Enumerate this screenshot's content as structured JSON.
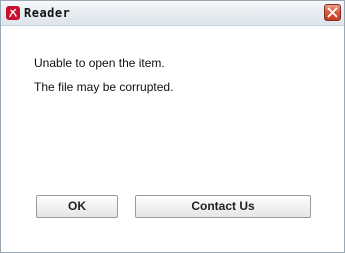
{
  "window": {
    "title": "Reader",
    "close_symbol": "✕"
  },
  "dialog": {
    "line1": "Unable to open the item.",
    "line2": "The file may be corrupted."
  },
  "buttons": {
    "ok_label": "OK",
    "contact_label": "Contact Us"
  },
  "colors": {
    "app_icon": "#c8102e",
    "close_button": "#c94a30"
  },
  "icons": {
    "app": "reader-app-icon",
    "close": "close-icon"
  }
}
